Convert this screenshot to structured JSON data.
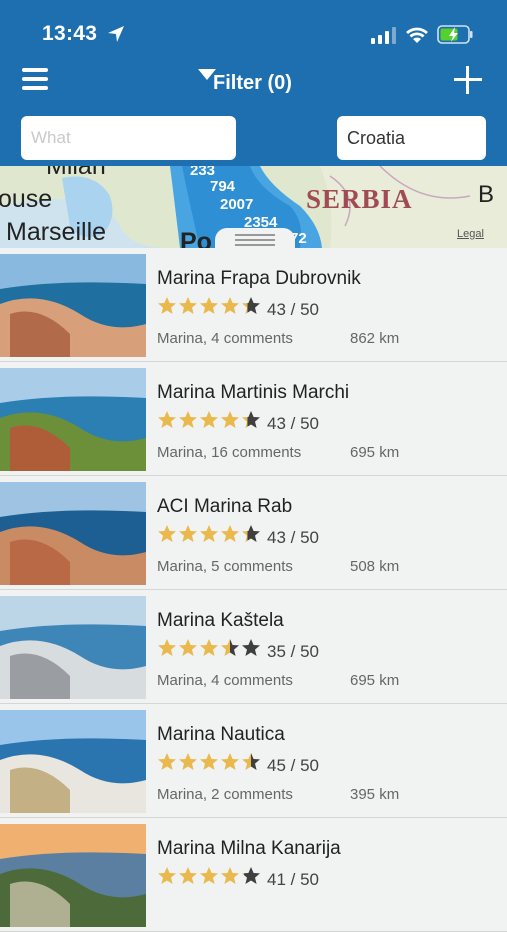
{
  "status": {
    "time": "13:43"
  },
  "nav": {
    "filter_label": "Filter (0)"
  },
  "search": {
    "what_placeholder": "What",
    "country": "Croatia"
  },
  "map": {
    "labels": [
      "Milan",
      "ouse",
      "Marseille",
      "SERBIA",
      "B",
      "Legal",
      "Po"
    ],
    "clusters": [
      "233",
      "794",
      "2007",
      "2354",
      "72"
    ]
  },
  "marinas": [
    {
      "name": "Marina Frapa Dubrovnik",
      "rating": "43 / 50",
      "stars": 4.3,
      "meta": "Marina, 4 comments",
      "distance": "862 km"
    },
    {
      "name": "Marina Martinis Marchi",
      "rating": "43 / 50",
      "stars": 4.3,
      "meta": "Marina, 16 comments",
      "distance": "695 km"
    },
    {
      "name": "ACI Marina Rab",
      "rating": "43 / 50",
      "stars": 4.3,
      "meta": "Marina, 5 comments",
      "distance": "508 km"
    },
    {
      "name": "Marina Kaštela",
      "rating": "35 / 50",
      "stars": 3.5,
      "meta": "Marina, 4 comments",
      "distance": "695 km"
    },
    {
      "name": "Marina Nautica",
      "rating": "45 / 50",
      "stars": 4.5,
      "meta": "Marina, 2 comments",
      "distance": "395 km"
    },
    {
      "name": "Marina Milna Kanarija",
      "rating": "41 / 50",
      "stars": 4.1,
      "meta": "",
      "distance": ""
    }
  ]
}
